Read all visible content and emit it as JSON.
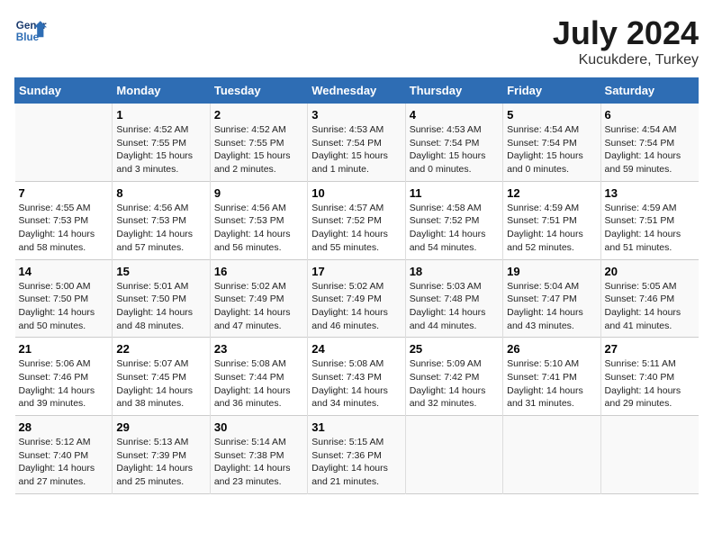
{
  "header": {
    "logo_line1": "General",
    "logo_line2": "Blue",
    "title": "July 2024",
    "subtitle": "Kucukdere, Turkey"
  },
  "days_of_week": [
    "Sunday",
    "Monday",
    "Tuesday",
    "Wednesday",
    "Thursday",
    "Friday",
    "Saturday"
  ],
  "weeks": [
    [
      {
        "date": "",
        "info": ""
      },
      {
        "date": "1",
        "info": "Sunrise: 4:52 AM\nSunset: 7:55 PM\nDaylight: 15 hours\nand 3 minutes."
      },
      {
        "date": "2",
        "info": "Sunrise: 4:52 AM\nSunset: 7:55 PM\nDaylight: 15 hours\nand 2 minutes."
      },
      {
        "date": "3",
        "info": "Sunrise: 4:53 AM\nSunset: 7:54 PM\nDaylight: 15 hours\nand 1 minute."
      },
      {
        "date": "4",
        "info": "Sunrise: 4:53 AM\nSunset: 7:54 PM\nDaylight: 15 hours\nand 0 minutes."
      },
      {
        "date": "5",
        "info": "Sunrise: 4:54 AM\nSunset: 7:54 PM\nDaylight: 15 hours\nand 0 minutes."
      },
      {
        "date": "6",
        "info": "Sunrise: 4:54 AM\nSunset: 7:54 PM\nDaylight: 14 hours\nand 59 minutes."
      }
    ],
    [
      {
        "date": "7",
        "info": "Sunrise: 4:55 AM\nSunset: 7:53 PM\nDaylight: 14 hours\nand 58 minutes."
      },
      {
        "date": "8",
        "info": "Sunrise: 4:56 AM\nSunset: 7:53 PM\nDaylight: 14 hours\nand 57 minutes."
      },
      {
        "date": "9",
        "info": "Sunrise: 4:56 AM\nSunset: 7:53 PM\nDaylight: 14 hours\nand 56 minutes."
      },
      {
        "date": "10",
        "info": "Sunrise: 4:57 AM\nSunset: 7:52 PM\nDaylight: 14 hours\nand 55 minutes."
      },
      {
        "date": "11",
        "info": "Sunrise: 4:58 AM\nSunset: 7:52 PM\nDaylight: 14 hours\nand 54 minutes."
      },
      {
        "date": "12",
        "info": "Sunrise: 4:59 AM\nSunset: 7:51 PM\nDaylight: 14 hours\nand 52 minutes."
      },
      {
        "date": "13",
        "info": "Sunrise: 4:59 AM\nSunset: 7:51 PM\nDaylight: 14 hours\nand 51 minutes."
      }
    ],
    [
      {
        "date": "14",
        "info": "Sunrise: 5:00 AM\nSunset: 7:50 PM\nDaylight: 14 hours\nand 50 minutes."
      },
      {
        "date": "15",
        "info": "Sunrise: 5:01 AM\nSunset: 7:50 PM\nDaylight: 14 hours\nand 48 minutes."
      },
      {
        "date": "16",
        "info": "Sunrise: 5:02 AM\nSunset: 7:49 PM\nDaylight: 14 hours\nand 47 minutes."
      },
      {
        "date": "17",
        "info": "Sunrise: 5:02 AM\nSunset: 7:49 PM\nDaylight: 14 hours\nand 46 minutes."
      },
      {
        "date": "18",
        "info": "Sunrise: 5:03 AM\nSunset: 7:48 PM\nDaylight: 14 hours\nand 44 minutes."
      },
      {
        "date": "19",
        "info": "Sunrise: 5:04 AM\nSunset: 7:47 PM\nDaylight: 14 hours\nand 43 minutes."
      },
      {
        "date": "20",
        "info": "Sunrise: 5:05 AM\nSunset: 7:46 PM\nDaylight: 14 hours\nand 41 minutes."
      }
    ],
    [
      {
        "date": "21",
        "info": "Sunrise: 5:06 AM\nSunset: 7:46 PM\nDaylight: 14 hours\nand 39 minutes."
      },
      {
        "date": "22",
        "info": "Sunrise: 5:07 AM\nSunset: 7:45 PM\nDaylight: 14 hours\nand 38 minutes."
      },
      {
        "date": "23",
        "info": "Sunrise: 5:08 AM\nSunset: 7:44 PM\nDaylight: 14 hours\nand 36 minutes."
      },
      {
        "date": "24",
        "info": "Sunrise: 5:08 AM\nSunset: 7:43 PM\nDaylight: 14 hours\nand 34 minutes."
      },
      {
        "date": "25",
        "info": "Sunrise: 5:09 AM\nSunset: 7:42 PM\nDaylight: 14 hours\nand 32 minutes."
      },
      {
        "date": "26",
        "info": "Sunrise: 5:10 AM\nSunset: 7:41 PM\nDaylight: 14 hours\nand 31 minutes."
      },
      {
        "date": "27",
        "info": "Sunrise: 5:11 AM\nSunset: 7:40 PM\nDaylight: 14 hours\nand 29 minutes."
      }
    ],
    [
      {
        "date": "28",
        "info": "Sunrise: 5:12 AM\nSunset: 7:40 PM\nDaylight: 14 hours\nand 27 minutes."
      },
      {
        "date": "29",
        "info": "Sunrise: 5:13 AM\nSunset: 7:39 PM\nDaylight: 14 hours\nand 25 minutes."
      },
      {
        "date": "30",
        "info": "Sunrise: 5:14 AM\nSunset: 7:38 PM\nDaylight: 14 hours\nand 23 minutes."
      },
      {
        "date": "31",
        "info": "Sunrise: 5:15 AM\nSunset: 7:36 PM\nDaylight: 14 hours\nand 21 minutes."
      },
      {
        "date": "",
        "info": ""
      },
      {
        "date": "",
        "info": ""
      },
      {
        "date": "",
        "info": ""
      }
    ]
  ]
}
